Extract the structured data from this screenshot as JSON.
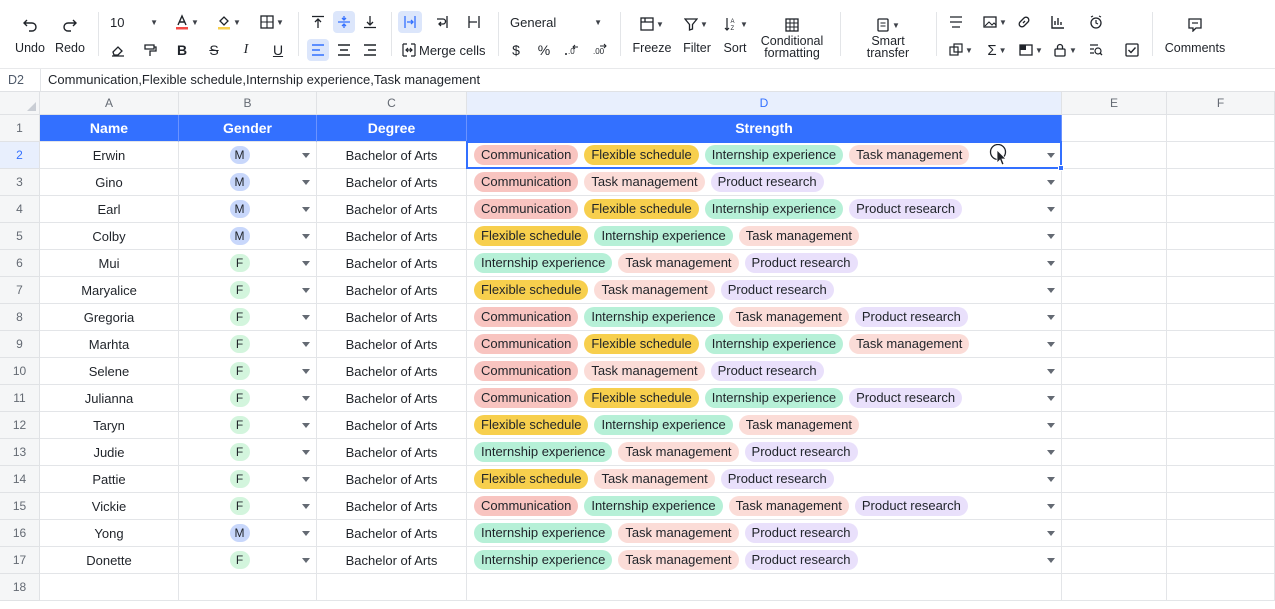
{
  "toolbar": {
    "undo": "Undo",
    "redo": "Redo",
    "font_size": "10",
    "number_format": "General",
    "merge_cells": "Merge cells",
    "currency_symbol": "$",
    "percent_symbol": "%",
    "freeze": "Freeze",
    "filter": "Filter",
    "sort": "Sort",
    "conditional_formatting_line1": "Conditional",
    "conditional_formatting_line2": "formatting",
    "smart_transfer_line1": "Smart",
    "smart_transfer_line2": "transfer",
    "comments": "Comments"
  },
  "formula_bar": {
    "cell_ref": "D2",
    "content": "Communication,Flexible schedule,Internship experience,Task management"
  },
  "colors": {
    "accent": "#3370ff",
    "header_fill": "#3370ff",
    "tag_communication": "#f8c4c0",
    "tag_flexible_schedule": "#f7cf4d",
    "tag_internship_experience": "#b6f0d7",
    "tag_task_management": "#fbdcd7",
    "tag_product_research": "#e9e0fb",
    "gender_m": "#c8d7fb",
    "gender_f": "#d3f5dd"
  },
  "grid": {
    "columns": [
      "A",
      "B",
      "C",
      "D",
      "E",
      "F"
    ],
    "active_column": "D",
    "active_row": "2",
    "row_numbers": [
      "1",
      "2",
      "3",
      "4",
      "5",
      "6",
      "7",
      "8",
      "9",
      "10",
      "11",
      "12",
      "13",
      "14",
      "15",
      "16",
      "17",
      "18"
    ],
    "headers": [
      "Name",
      "Gender",
      "Degree",
      "Strength"
    ],
    "rows": [
      {
        "name": "Erwin",
        "gender": "M",
        "degree": "Bachelor of Arts",
        "strengths": [
          "Communication",
          "Flexible schedule",
          "Internship experience",
          "Task management"
        ]
      },
      {
        "name": "Gino",
        "gender": "M",
        "degree": "Bachelor of Arts",
        "strengths": [
          "Communication",
          "Task management",
          "Product research"
        ]
      },
      {
        "name": "Earl",
        "gender": "M",
        "degree": "Bachelor of Arts",
        "strengths": [
          "Communication",
          "Flexible schedule",
          "Internship experience",
          "Product research"
        ]
      },
      {
        "name": "Colby",
        "gender": "M",
        "degree": "Bachelor of Arts",
        "strengths": [
          "Flexible schedule",
          "Internship experience",
          "Task management"
        ]
      },
      {
        "name": "Mui",
        "gender": "F",
        "degree": "Bachelor of Arts",
        "strengths": [
          "Internship experience",
          "Task management",
          "Product research"
        ]
      },
      {
        "name": "Maryalice",
        "gender": "F",
        "degree": "Bachelor of Arts",
        "strengths": [
          "Flexible schedule",
          "Task management",
          "Product research"
        ]
      },
      {
        "name": "Gregoria",
        "gender": "F",
        "degree": "Bachelor of Arts",
        "strengths": [
          "Communication",
          "Internship experience",
          "Task management",
          "Product research"
        ]
      },
      {
        "name": "Marhta",
        "gender": "F",
        "degree": "Bachelor of Arts",
        "strengths": [
          "Communication",
          "Flexible schedule",
          "Internship experience",
          "Task management"
        ]
      },
      {
        "name": "Selene",
        "gender": "F",
        "degree": "Bachelor of Arts",
        "strengths": [
          "Communication",
          "Task management",
          "Product research"
        ]
      },
      {
        "name": "Julianna",
        "gender": "F",
        "degree": "Bachelor of Arts",
        "strengths": [
          "Communication",
          "Flexible schedule",
          "Internship experience",
          "Product research"
        ]
      },
      {
        "name": "Taryn",
        "gender": "F",
        "degree": "Bachelor of Arts",
        "strengths": [
          "Flexible schedule",
          "Internship experience",
          "Task management"
        ]
      },
      {
        "name": "Judie",
        "gender": "F",
        "degree": "Bachelor of Arts",
        "strengths": [
          "Internship experience",
          "Task management",
          "Product research"
        ]
      },
      {
        "name": "Pattie",
        "gender": "F",
        "degree": "Bachelor of Arts",
        "strengths": [
          "Flexible schedule",
          "Task management",
          "Product research"
        ]
      },
      {
        "name": "Vickie",
        "gender": "F",
        "degree": "Bachelor of Arts",
        "strengths": [
          "Communication",
          "Internship experience",
          "Task management",
          "Product research"
        ]
      },
      {
        "name": "Yong",
        "gender": "M",
        "degree": "Bachelor of Arts",
        "strengths": [
          "Internship experience",
          "Task management",
          "Product research"
        ]
      },
      {
        "name": "Donette",
        "gender": "F",
        "degree": "Bachelor of Arts",
        "strengths": [
          "Internship experience",
          "Task management",
          "Product research"
        ]
      }
    ]
  }
}
